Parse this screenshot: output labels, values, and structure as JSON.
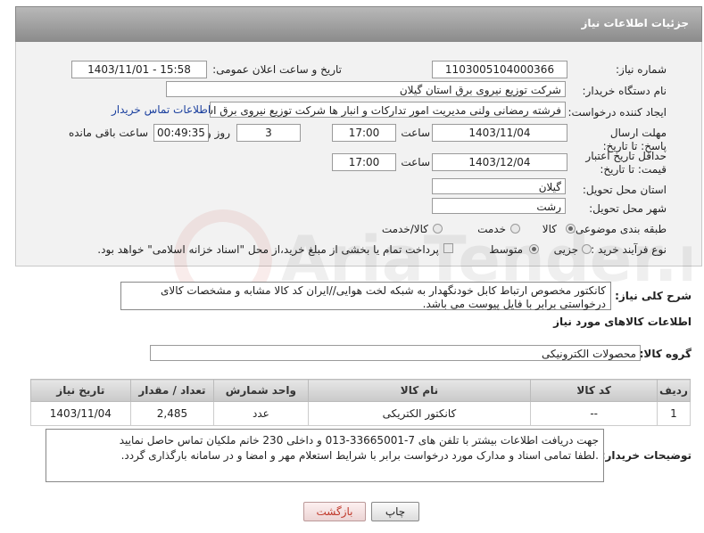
{
  "page_title": "جزئیات اطلاعات نیاز",
  "fields": {
    "need_number_label": "شماره نیاز:",
    "need_number": "1103005104000366",
    "announce_label": "تاریخ و ساعت اعلان عمومی:",
    "announce_value": "1403/11/01 - 15:58",
    "buyer_org_label": "نام دستگاه خریدار:",
    "buyer_org": "شرکت توزیع نیروی برق استان گیلان",
    "creator_label": "ایجاد کننده درخواست:",
    "creator": "فرشته رمضانی ولنی مدیریت امور تدارکات و انبار ها شرکت توزیع نیروی برق استان گیلان",
    "contact_link": "اطلاعات تماس خریدار",
    "reply_deadline_label": "مهلت ارسال پاسخ: تا تاریخ:",
    "reply_date": "1403/11/04",
    "time_label": "ساعت",
    "reply_time": "17:00",
    "days_value": "3",
    "days_label": "روز و",
    "remaining_time": "00:49:35",
    "remaining_label": "ساعت باقی مانده",
    "price_validity_label": "حداقل تاریخ اعتبار قیمت: تا تاریخ:",
    "validity_date": "1403/12/04",
    "validity_time": "17:00",
    "province_label": "استان محل تحویل:",
    "province": "گیلان",
    "city_label": "شهر محل تحویل:",
    "city": "رشت",
    "category_label": "طبقه بندی موضوعی:",
    "category_options": [
      "کالا",
      "خدمت",
      "کالا/خدمت"
    ],
    "purchase_type_label": "نوع فرآیند خرید :",
    "purchase_options": [
      "جزیی",
      "متوسط"
    ],
    "payment_note": "پرداخت تمام یا بخشی از مبلغ خرید،از محل \"اسناد خزانه اسلامی\" خواهد بود."
  },
  "summary": {
    "label": "شرح کلی نیاز:",
    "text": "کانکتور مخصوص ارتباط کابل خودنگهدار به شبکه لخت هوایی//ایران کد کالا مشابه و مشخصات کالای درخواستی برابر با فایل پیوست می باشد."
  },
  "goods_section_title": "اطلاعات کالاهای مورد نیاز",
  "goods_group_label": "گروه کالا:",
  "goods_group": "محصولات الکترونیکی",
  "table": {
    "headers": [
      "ردیف",
      "کد کالا",
      "نام کالا",
      "واحد شمارش",
      "تعداد / مقدار",
      "تاریخ نیاز"
    ],
    "rows": [
      [
        "1",
        "--",
        "کانکتور الکتریکی",
        "عدد",
        "2,485",
        "1403/11/04"
      ]
    ]
  },
  "buyer_notes": {
    "label": "توضیحات خریدار:",
    "line1": "جهت دریافت اطلاعات بیشتر با تلفن های 7-33665001-013 و داخلی 230 خانم ملکیان تماس حاصل نمایید",
    "line2": ".لطفا تمامی اسناد و مدارک مورد درخواست برابر با شرایط استعلام مهر و امضا و در سامانه بارگذاری گردد."
  },
  "buttons": {
    "print": "چاپ",
    "back": "بازگشت"
  },
  "colors": {
    "header": "#9a9a9a",
    "link": "#1a3f9e",
    "back_button_text": "#c0392b"
  },
  "watermark_text": "AriaTender.neT"
}
